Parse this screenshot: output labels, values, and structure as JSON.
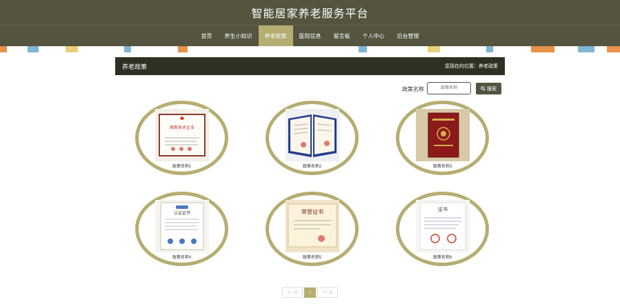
{
  "header": {
    "title": "智能居家养老服务平台"
  },
  "nav": {
    "items": [
      {
        "label": "首页"
      },
      {
        "label": "养生小知识"
      },
      {
        "label": "养老政策"
      },
      {
        "label": "医院信息"
      },
      {
        "label": "留言板"
      },
      {
        "label": "个人中心"
      },
      {
        "label": "后台管理"
      }
    ],
    "active_index": 2
  },
  "page": {
    "heading": "养老政策",
    "breadcrumb": "您现在的位置：养老政策"
  },
  "search": {
    "label": "政策名称",
    "placeholder": "政策名称",
    "button_label": "搜索"
  },
  "cards": [
    {
      "name": "政策名称1",
      "image_title": "高新技术企业"
    },
    {
      "name": "政策名称2"
    },
    {
      "name": "政策名称3"
    },
    {
      "name": "政策名称4",
      "image_title": "认证证书"
    },
    {
      "name": "政策名称5",
      "image_title": "荣誉证书"
    },
    {
      "name": "政策名称6",
      "image_title": "证书"
    }
  ],
  "pagination": {
    "prev_label": "上一页",
    "current_page": "1",
    "next_label": "下一页"
  },
  "colors": {
    "header_bg": "#54543f",
    "accent": "#b6ad72",
    "page_bar_bg": "#2e3121"
  }
}
